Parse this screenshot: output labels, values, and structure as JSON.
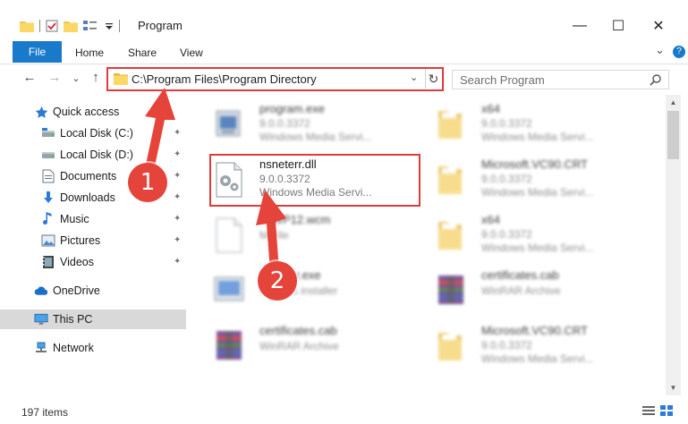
{
  "window": {
    "title": "Program",
    "minimize": "—",
    "maximize": "☐",
    "close": "✕"
  },
  "ribbon": {
    "tabs": [
      "File",
      "Home",
      "Share",
      "View"
    ],
    "expand": "⌄",
    "help": "?"
  },
  "address": {
    "path": "C:\\Program Files\\Program Directory",
    "dropdown": "⌄",
    "refresh": "↻"
  },
  "search": {
    "placeholder": "Search Program"
  },
  "nav": {
    "back": "←",
    "forward": "→",
    "recent": "⌄",
    "up": "↑"
  },
  "sidebar": {
    "items": [
      {
        "label": "Quick access",
        "icon": "star-icon",
        "pinned": false
      },
      {
        "label": "Local Disk (C:)",
        "icon": "drive-icon",
        "pinned": true
      },
      {
        "label": "Local Disk (D:)",
        "icon": "drive-icon",
        "pinned": true
      },
      {
        "label": "Documents",
        "icon": "documents-icon",
        "pinned": true
      },
      {
        "label": "Downloads",
        "icon": "download-icon",
        "pinned": true
      },
      {
        "label": "Music",
        "icon": "music-icon",
        "pinned": true
      },
      {
        "label": "Pictures",
        "icon": "pictures-icon",
        "pinned": true
      },
      {
        "label": "Videos",
        "icon": "videos-icon",
        "pinned": true
      },
      {
        "label": "OneDrive",
        "icon": "cloud-icon",
        "pinned": false
      },
      {
        "label": "This PC",
        "icon": "computer-icon",
        "pinned": false
      },
      {
        "label": "Network",
        "icon": "network-icon",
        "pinned": false
      }
    ],
    "pin_glyph": "📌"
  },
  "files": [
    {
      "name": "program.exe",
      "line2": "9.0.0.3372",
      "line3": "Windows Media Servi...",
      "icon": "exe-icon"
    },
    {
      "name": "x64",
      "line2": "9.0.0.3372",
      "line3": "Windows Media Servi...",
      "icon": "folder-icon"
    },
    {
      "name": "nsneterr.dll",
      "line2": "9.0.0.3372",
      "line3": "Windows Media Servi...",
      "icon": "dll-gear-icon"
    },
    {
      "name": "Microsoft.VC90.CRT",
      "line2": "9.0.0.3372",
      "line3": "Windows Media Servi...",
      "icon": "folder-icon"
    },
    {
      "name": "ToWP12.wcm",
      "line2": "",
      "line3": "M File",
      "icon": "file-icon"
    },
    {
      "name": "x64",
      "line2": "9.0.0.3372",
      "line3": "Windows Media Servi...",
      "icon": "folder-icon"
    },
    {
      "name": "installer.exe",
      "line2": "",
      "line3": "updates installer",
      "icon": "installer-icon"
    },
    {
      "name": "certificates.cab",
      "line2": "",
      "line3": "WinRAR Archive",
      "icon": "winrar-icon"
    },
    {
      "name": "certificates.cab",
      "line2": "",
      "line3": "WinRAR Archive",
      "icon": "winrar-icon"
    },
    {
      "name": "Microsoft.VC90.CRT",
      "line2": "9.0.0.3372",
      "line3": "Windows Media Servi...",
      "icon": "folder-icon"
    }
  ],
  "status": {
    "item_count": "197 items"
  },
  "annotations": {
    "step1": "1",
    "step2": "2",
    "color": "#e5443a"
  },
  "colors": {
    "accent": "#1979ca",
    "highlight": "#e03a3a",
    "selected": "#d9d9d9"
  }
}
